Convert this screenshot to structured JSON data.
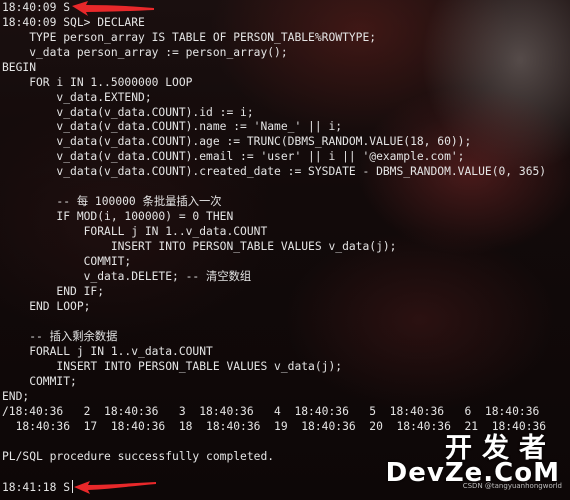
{
  "terminal": {
    "lines": [
      "18:40:09 S",
      "18:40:09 SQL> DECLARE",
      "    TYPE person_array IS TABLE OF PERSON_TABLE%ROWTYPE;",
      "    v_data person_array := person_array();",
      "BEGIN",
      "    FOR i IN 1..5000000 LOOP",
      "        v_data.EXTEND;",
      "        v_data(v_data.COUNT).id := i;",
      "        v_data(v_data.COUNT).name := 'Name_' || i;",
      "        v_data(v_data.COUNT).age := TRUNC(DBMS_RANDOM.VALUE(18, 60));",
      "        v_data(v_data.COUNT).email := 'user' || i || '@example.com';",
      "        v_data(v_data.COUNT).created_date := SYSDATE - DBMS_RANDOM.VALUE(0, 365)",
      "",
      "        -- 每 100000 条批量插入一次",
      "        IF MOD(i, 100000) = 0 THEN",
      "            FORALL j IN 1..v_data.COUNT",
      "                INSERT INTO PERSON_TABLE VALUES v_data(j);",
      "            COMMIT;",
      "            v_data.DELETE; -- 清空数组",
      "        END IF;",
      "    END LOOP;",
      "",
      "    -- 插入剩余数据",
      "    FORALL j IN 1..v_data.COUNT",
      "        INSERT INTO PERSON_TABLE VALUES v_data(j);",
      "    COMMIT;",
      "END;",
      "/18:40:36   2  18:40:36   3  18:40:36   4  18:40:36   5  18:40:36   6  18:40:36",
      "  18:40:36  17  18:40:36  18  18:40:36  19  18:40:36  20  18:40:36  21  18:40:36",
      "",
      "PL/SQL procedure successfully completed.",
      "",
      "18:41:18 S"
    ]
  },
  "watermark": {
    "cn": "开发者",
    "en": "DevZe.CoM",
    "sub": "CSDN @tangyuanhongworld"
  },
  "colors": {
    "text": "#e4e4e4",
    "arrow": "#e8282a",
    "background": "#0c0808"
  },
  "icons": [
    "red-arrow-icon",
    "red-arrow-icon"
  ]
}
